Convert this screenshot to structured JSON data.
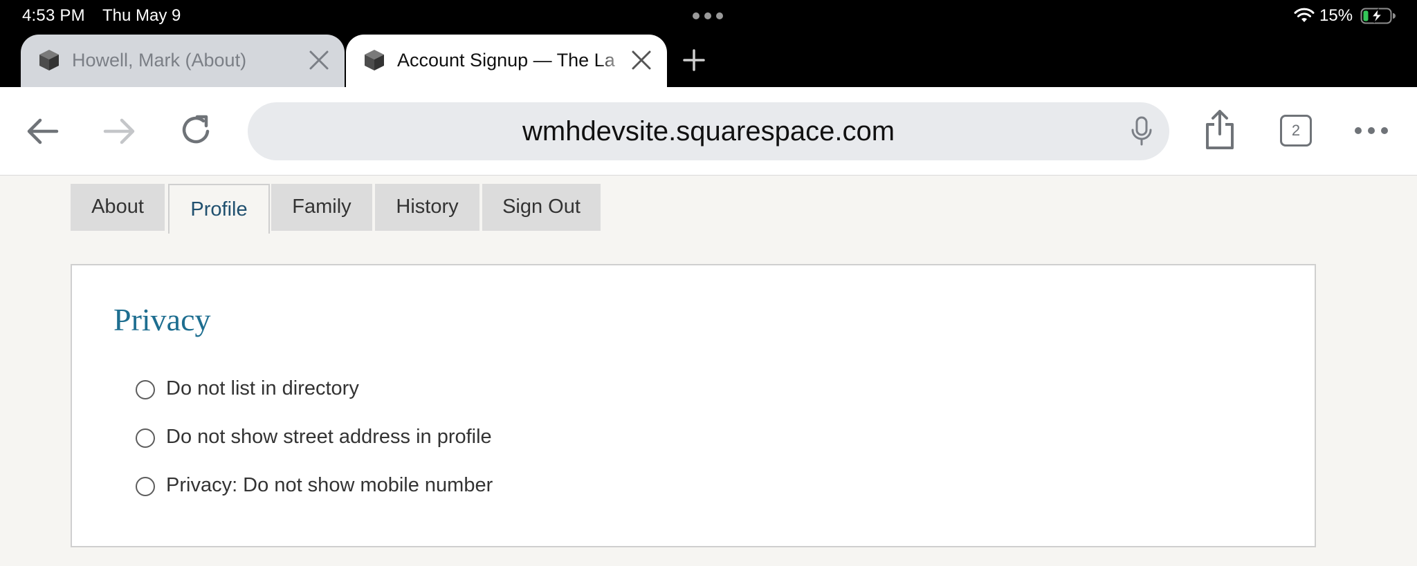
{
  "status_bar": {
    "time": "4:53 PM",
    "date": "Thu May 9",
    "battery_percent": "15%"
  },
  "browser": {
    "tabs": [
      {
        "title": "Howell, Mark (About)",
        "active": false
      },
      {
        "title": "Account Signup — The La",
        "active": true
      }
    ],
    "url": "wmhdevsite.squarespace.com",
    "open_tab_count": "2"
  },
  "page": {
    "nav_tabs": [
      {
        "label": "About",
        "active": false
      },
      {
        "label": "Profile",
        "active": true
      },
      {
        "label": "Family",
        "active": false
      },
      {
        "label": "History",
        "active": false
      },
      {
        "label": "Sign Out",
        "active": false
      }
    ],
    "section_title": "Privacy",
    "options": [
      {
        "label": "Do not list in directory",
        "checked": false
      },
      {
        "label": "Do not show street address in profile",
        "checked": false
      },
      {
        "label": "Privacy: Do not show mobile number",
        "checked": false
      }
    ]
  },
  "colors": {
    "accent_title": "#1e6e90",
    "active_tab_text": "#20506f",
    "page_background": "#f6f5f2"
  }
}
